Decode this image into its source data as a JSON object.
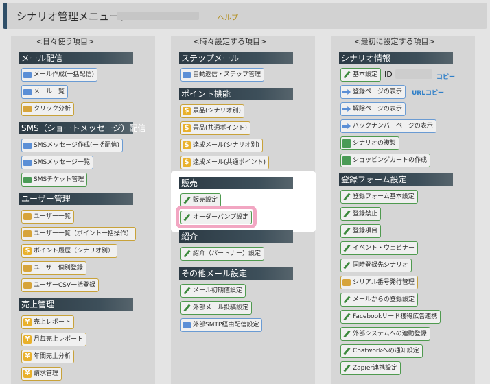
{
  "header": {
    "title": "シナリオ管理メニュー：",
    "help": "ヘルプ"
  },
  "columns": {
    "daily": "<日々使う項目>",
    "sometimes": "<時々設定する項目>",
    "first": "<最初に設定する項目>"
  },
  "daily": {
    "mail_section": "メール配信",
    "mail_create": "メール作成(一括配信)",
    "mail_list": "メール一覧",
    "click_analysis": "クリック分析",
    "sms_section": "SMS（ショートメッセージ）配信",
    "sms_create": "SMSメッセージ作成(一括配信)",
    "sms_list": "SMSメッセージ一覧",
    "sms_ticket": "SMSチケット管理",
    "user_section": "ユーザー管理",
    "user_list": "ユーザー一覧",
    "user_list_bulk": "ユーザー一覧（ポイント一括操作）",
    "point_history": "ポイント履歴（シナリオ別）",
    "user_individual": "ユーザー個別登録",
    "user_csv": "ユーザーCSV一括登録",
    "sales_section": "売上管理",
    "sales_report": "売上レポート",
    "monthly_report": "月毎売上レポート",
    "annual_analysis": "年間売上分析",
    "billing": "請求管理"
  },
  "sometimes": {
    "step_section": "ステップメール",
    "auto_reply": "自動返信・ステップ管理",
    "point_section": "ポイント機能",
    "prize_scenario": "景品(シナリオ別)",
    "prize_common": "景品(共通ポイント)",
    "achieve_scenario": "達成メール(シナリオ別)",
    "achieve_common": "達成メール(共通ポイント)",
    "sales_section": "販売",
    "sales_setting": "販売設定",
    "order_bump": "オーダーバンプ設定",
    "intro_section": "紹介",
    "intro_partner": "紹介（パートナー）設定",
    "other_section": "その他メール設定",
    "mail_initial": "メール初期値設定",
    "external_post": "外部メール投稿設定",
    "external_smtp": "外部SMTP経由配信設定"
  },
  "first": {
    "scenario_section": "シナリオ情報",
    "basic_setting": "基本設定",
    "id_label": "ID",
    "copy": "コピー",
    "register_page": "登録ページの表示",
    "url_copy": "URLコピー",
    "unsubscribe_page": "解除ページの表示",
    "backnumber_page": "バックナンバーページの表示",
    "duplicate": "シナリオの複製",
    "cart_create": "ショッピングカートの作成",
    "form_section": "登録フォーム設定",
    "form_basic": "登録フォーム基本設定",
    "register_block": "登録禁止",
    "register_items": "登録項目",
    "event_webinar": "イベント・ウェビナー",
    "concurrent": "同時登録先シナリオ",
    "serial": "シリアル番号発行管理",
    "from_mail": "メールからの登録設定",
    "facebook": "Facebookリード獲得広告連携",
    "external_system": "外部システムへの連動登録",
    "chatwork": "Chatworkへの通知設定",
    "zapier": "Zapier連携設定"
  }
}
